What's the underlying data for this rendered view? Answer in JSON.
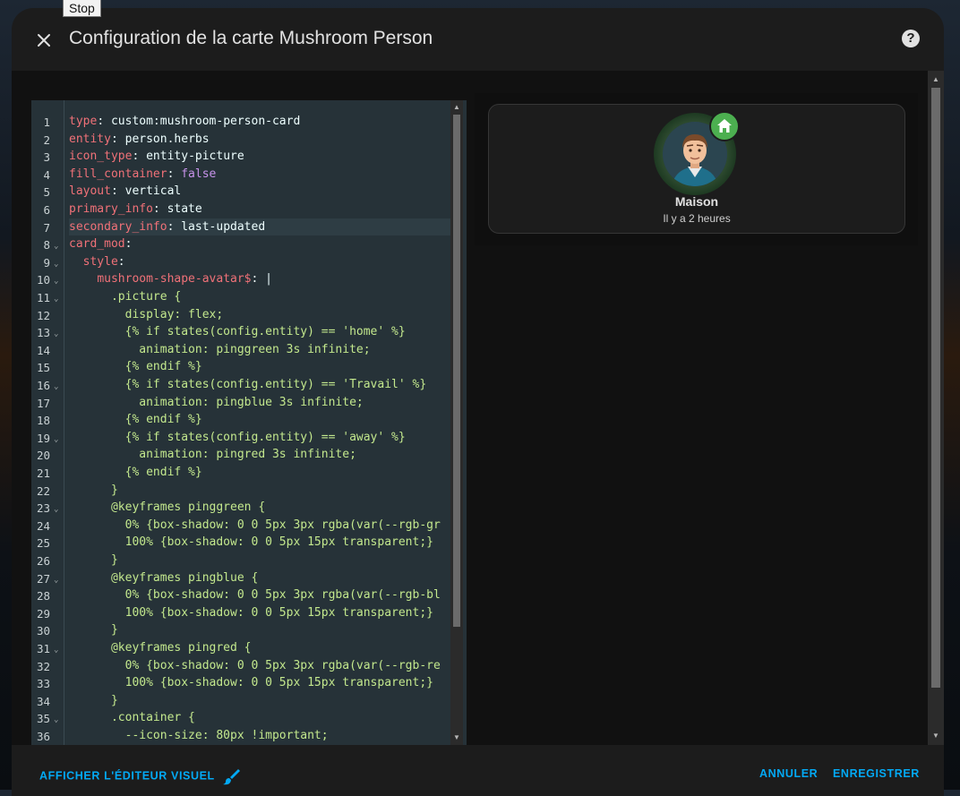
{
  "tooltip": "Stop",
  "dialog": {
    "title": "Configuration de la carte Mushroom Person",
    "close_icon": "close-icon",
    "help_icon": "help-icon",
    "help_glyph": "?"
  },
  "editor": {
    "active_line": 7,
    "lines": [
      [
        [
          "k",
          "type"
        ],
        [
          "d",
          ": "
        ],
        [
          "v",
          "custom:mushroom-person-card"
        ]
      ],
      [
        [
          "k",
          "entity"
        ],
        [
          "d",
          ": "
        ],
        [
          "v",
          "person.herbs"
        ]
      ],
      [
        [
          "k",
          "icon_type"
        ],
        [
          "d",
          ": "
        ],
        [
          "v",
          "entity-picture"
        ]
      ],
      [
        [
          "k",
          "fill_container"
        ],
        [
          "d",
          ": "
        ],
        [
          "b",
          "false"
        ]
      ],
      [
        [
          "k",
          "layout"
        ],
        [
          "d",
          ": "
        ],
        [
          "v",
          "vertical"
        ]
      ],
      [
        [
          "k",
          "primary_info"
        ],
        [
          "d",
          ": "
        ],
        [
          "v",
          "state"
        ]
      ],
      [
        [
          "k",
          "secondary_info"
        ],
        [
          "d",
          ": "
        ],
        [
          "v",
          "last-updated"
        ]
      ],
      [
        [
          "k",
          "card_mod"
        ],
        [
          "d",
          ":"
        ]
      ],
      [
        [
          "d",
          "  "
        ],
        [
          "k",
          "style"
        ],
        [
          "d",
          ":"
        ]
      ],
      [
        [
          "d",
          "    "
        ],
        [
          "k",
          "mushroom-shape-avatar$"
        ],
        [
          "d",
          ": |"
        ]
      ],
      [
        [
          "p",
          "      .picture {"
        ]
      ],
      [
        [
          "p",
          "        display: flex;"
        ]
      ],
      [
        [
          "p",
          "        {% if states(config.entity) == 'home' %}"
        ]
      ],
      [
        [
          "p",
          "          animation: pinggreen 3s infinite;"
        ]
      ],
      [
        [
          "p",
          "        {% endif %}"
        ]
      ],
      [
        [
          "p",
          "        {% if states(config.entity) == 'Travail' %}"
        ]
      ],
      [
        [
          "p",
          "          animation: pingblue 3s infinite;"
        ]
      ],
      [
        [
          "p",
          "        {% endif %}"
        ]
      ],
      [
        [
          "p",
          "        {% if states(config.entity) == 'away' %}"
        ]
      ],
      [
        [
          "p",
          "          animation: pingred 3s infinite;"
        ]
      ],
      [
        [
          "p",
          "        {% endif %}"
        ]
      ],
      [
        [
          "p",
          "      }"
        ]
      ],
      [
        [
          "p",
          "      @keyframes pinggreen {"
        ]
      ],
      [
        [
          "p",
          "        0% {box-shadow: 0 0 5px 3px rgba(var(--rgb-gr"
        ]
      ],
      [
        [
          "p",
          "        100% {box-shadow: 0 0 5px 15px transparent;}"
        ]
      ],
      [
        [
          "p",
          "      }"
        ]
      ],
      [
        [
          "p",
          "      @keyframes pingblue {"
        ]
      ],
      [
        [
          "p",
          "        0% {box-shadow: 0 0 5px 3px rgba(var(--rgb-bl"
        ]
      ],
      [
        [
          "p",
          "        100% {box-shadow: 0 0 5px 15px transparent;}"
        ]
      ],
      [
        [
          "p",
          "      }"
        ]
      ],
      [
        [
          "p",
          "      @keyframes pingred {"
        ]
      ],
      [
        [
          "p",
          "        0% {box-shadow: 0 0 5px 3px rgba(var(--rgb-re"
        ]
      ],
      [
        [
          "p",
          "        100% {box-shadow: 0 0 5px 15px transparent;}"
        ]
      ],
      [
        [
          "p",
          "      }"
        ]
      ],
      [
        [
          "p",
          "      .container {"
        ]
      ],
      [
        [
          "p",
          "        --icon-size: 80px !important;"
        ]
      ]
    ],
    "fold_lines": [
      8,
      9,
      10,
      11,
      13,
      16,
      19,
      23,
      27,
      31,
      35
    ],
    "fold_glyph": "⌄",
    "scroll_up_glyph": "▲",
    "scroll_down_glyph": "▼"
  },
  "preview": {
    "primary": "Maison",
    "secondary": "Il y a 2 heures",
    "badge_icon": "home-icon",
    "avatar_icon": "person-avatar-icon",
    "badge_color": "#4caf50"
  },
  "footer": {
    "visual_editor_label": "AFFICHER L'ÉDITEUR VISUEL",
    "visual_editor_icon": "brush-icon",
    "cancel_label": "ANNULER",
    "save_label": "ENREGISTRER"
  },
  "colors": {
    "accent": "#03a9f4",
    "editor_bg": "#263238",
    "key": "#f07178",
    "string": "#c3e88d",
    "boolean": "#c792ea"
  }
}
